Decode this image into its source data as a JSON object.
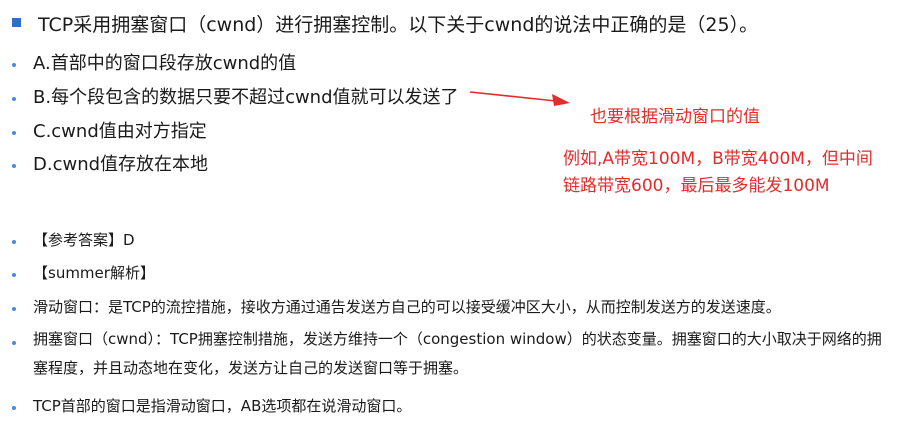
{
  "question": {
    "text": "TCP采用拥塞窗口（cwnd）进行拥塞控制。以下关于cwnd的说法中正确的是（25）。"
  },
  "options": [
    {
      "text": "A.首部中的窗口段存放cwnd的值"
    },
    {
      "text": "B.每个段包含的数据只要不超过cwnd值就可以发送了"
    },
    {
      "text": "C.cwnd值由对方指定"
    },
    {
      "text": "D.cwnd值存放在本地"
    }
  ],
  "annotation": {
    "arrow_note": "也要根据滑动窗口的值",
    "example": "例如,A带宽100M，B带宽400M，但中间链路带宽600，最后最多能发100M",
    "color": "#e52b2b"
  },
  "answer": {
    "reference": "【参考答案】D",
    "analysis_heading": "【summer解析】",
    "points": [
      "滑动窗口：是TCP的流控措施，接收方通过通告发送方自己的可以接受缓冲区大小，从而控制发送方的发送速度。",
      "拥塞窗口（cwnd）：TCP拥塞控制措施，发送方维持一个（congestion window）的状态变量。拥塞窗口的大小取决于网络的拥塞程度，并且动态地在变化，发送方让自己的发送窗口等于拥塞。",
      "TCP首部的窗口是指滑动窗口，AB选项都在说滑动窗口。"
    ]
  },
  "colors": {
    "bullet": "#2c6fd1",
    "text": "#1a1a1a"
  }
}
